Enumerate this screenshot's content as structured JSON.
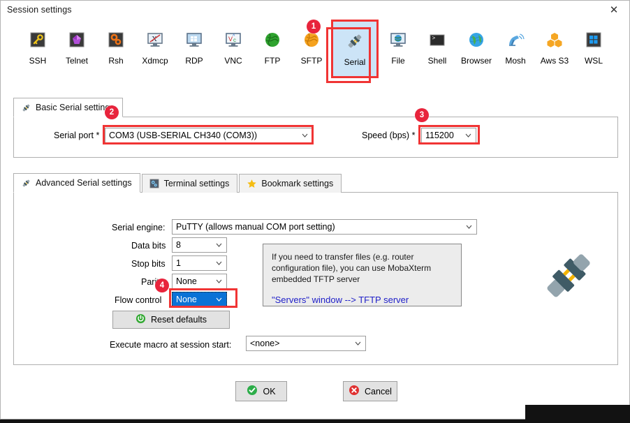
{
  "window": {
    "title": "Session settings",
    "close_label": "✕"
  },
  "session_types": [
    {
      "label": "SSH",
      "icon": "ssh-key-icon",
      "selected": false
    },
    {
      "label": "Telnet",
      "icon": "telnet-gem-icon",
      "selected": false
    },
    {
      "label": "Rsh",
      "icon": "rsh-gears-icon",
      "selected": false
    },
    {
      "label": "Xdmcp",
      "icon": "xdmcp-monitor-icon",
      "selected": false
    },
    {
      "label": "RDP",
      "icon": "rdp-monitor-icon",
      "selected": false
    },
    {
      "label": "VNC",
      "icon": "vnc-monitor-icon",
      "selected": false
    },
    {
      "label": "FTP",
      "icon": "ftp-globe-icon",
      "selected": false
    },
    {
      "label": "SFTP",
      "icon": "sftp-globe-icon",
      "selected": false
    },
    {
      "label": "Serial",
      "icon": "serial-plug-icon",
      "selected": true
    },
    {
      "label": "File",
      "icon": "file-monitor-icon",
      "selected": false
    },
    {
      "label": "Shell",
      "icon": "shell-terminal-icon",
      "selected": false
    },
    {
      "label": "Browser",
      "icon": "browser-globe-icon",
      "selected": false
    },
    {
      "label": "Mosh",
      "icon": "mosh-dish-icon",
      "selected": false
    },
    {
      "label": "Aws S3",
      "icon": "aws-s3-cubes-icon",
      "selected": false
    },
    {
      "label": "WSL",
      "icon": "wsl-windows-icon",
      "selected": false
    }
  ],
  "basic_panel": {
    "tab_label": "Basic Serial settings",
    "tab_icon": "serial-plug-icon",
    "serial_port": {
      "label": "Serial port",
      "required_mark": "*",
      "value": "COM3  (USB-SERIAL CH340 (COM3))"
    },
    "speed": {
      "label": "Speed (bps)",
      "required_mark": "*",
      "value": "115200"
    }
  },
  "advanced_panel": {
    "tabs": [
      {
        "label": "Advanced Serial settings",
        "icon": "serial-plug-icon",
        "active": true
      },
      {
        "label": "Terminal settings",
        "icon": "terminal-gear-icon",
        "active": false
      },
      {
        "label": "Bookmark settings",
        "icon": "bookmark-star-icon",
        "active": false
      }
    ],
    "serial_engine": {
      "label": "Serial engine:",
      "value": "PuTTY   (allows manual COM port setting)"
    },
    "data_bits": {
      "label": "Data bits",
      "value": "8"
    },
    "stop_bits": {
      "label": "Stop bits",
      "value": "1"
    },
    "parity": {
      "label": "Parity",
      "value": "None"
    },
    "flow_control": {
      "label": "Flow control",
      "value": "None",
      "focused": true
    },
    "reset_defaults": {
      "label": "Reset defaults",
      "icon": "reset-circle-icon"
    },
    "macro": {
      "label": "Execute macro at session start:",
      "value": "<none>"
    },
    "info": {
      "line1": "If you need to transfer files (e.g. router",
      "line2": "configuration file), you can use MobaXterm",
      "line3": "embedded TFTP server",
      "link": "\"Servers\" window  -->  TFTP server"
    },
    "decoration_icon": "serial-connector-art"
  },
  "footer": {
    "ok": {
      "label": "OK",
      "icon": "check-circle-icon"
    },
    "cancel": {
      "label": "Cancel",
      "icon": "cross-circle-icon"
    }
  },
  "annotations": [
    {
      "number": "1",
      "target": "serial-session-type"
    },
    {
      "number": "2",
      "target": "serial-port-combo"
    },
    {
      "number": "3",
      "target": "speed-combo"
    },
    {
      "number": "4",
      "target": "flow-control-combo"
    }
  ],
  "colors": {
    "highlight_red": "#f03434",
    "badge_red": "#e8243c",
    "selection_blue": "#0a72d6",
    "selected_tile": "#cce4f7",
    "link_blue": "#2020c8"
  }
}
